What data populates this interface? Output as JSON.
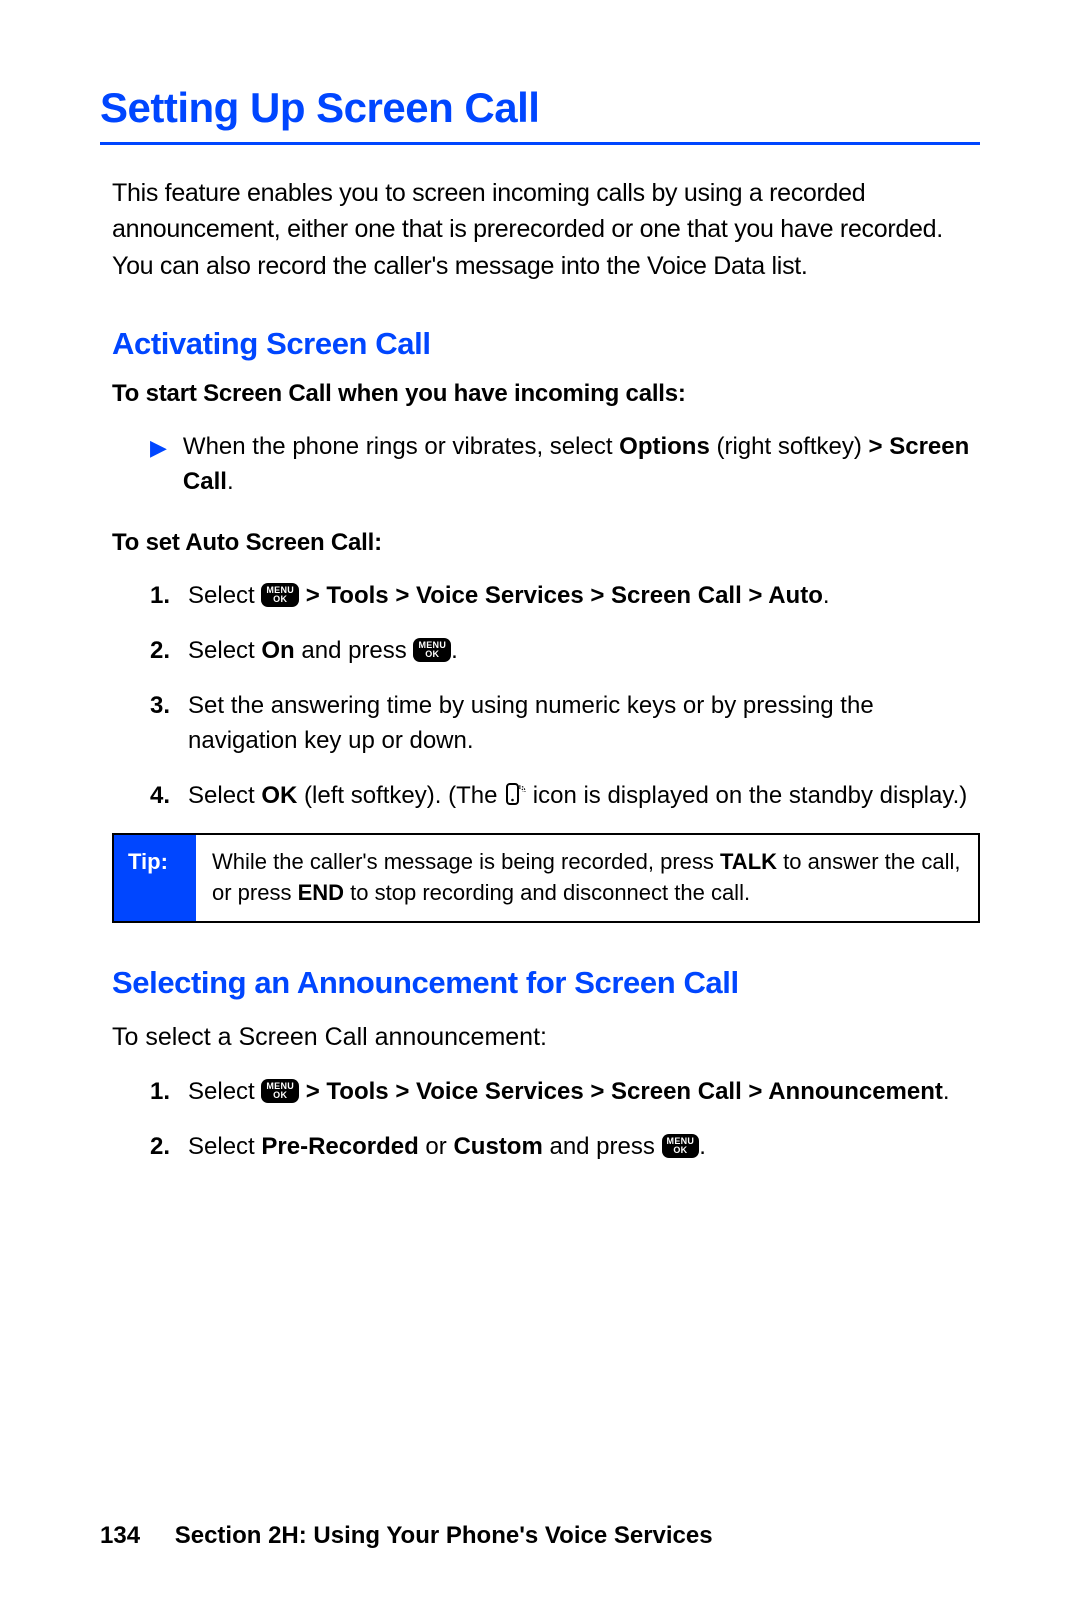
{
  "title": "Setting Up Screen Call",
  "intro": "This feature enables you to screen incoming calls by using a recorded announcement, either one that is prerecorded or one that you have recorded. You can also record the caller's message into the Voice Data list.",
  "section1": {
    "heading": "Activating Screen Call",
    "lead1": "To start Screen Call when you have incoming calls:",
    "arrow_pre": "When the phone rings or vibrates, select ",
    "arrow_bold1": "Options",
    "arrow_mid": " (right softkey) ",
    "arrow_bold2": "> Screen Call",
    "arrow_post": ".",
    "lead2": "To set Auto Screen Call:",
    "steps": {
      "s1_pre": "Select ",
      "s1_bold": " > Tools > Voice Services > Screen Call > Auto",
      "s1_post": ".",
      "s2_pre": "Select ",
      "s2_bold": "On",
      "s2_mid": " and press ",
      "s2_post": ".",
      "s3": "Set the answering time by using numeric keys or by pressing the navigation key up or down.",
      "s4_pre": "Select ",
      "s4_bold": "OK",
      "s4_mid": " (left softkey). (The ",
      "s4_post": " icon is displayed on the standby display.)"
    },
    "tip_label": "Tip:",
    "tip_pre": "While the caller's message is being recorded, press ",
    "tip_b1": "TALK",
    "tip_mid": " to answer the call, or press ",
    "tip_b2": "END",
    "tip_post": " to stop recording and disconnect the call."
  },
  "section2": {
    "heading": "Selecting an Announcement for Screen Call",
    "intro": "To select a Screen Call announcement:",
    "steps": {
      "s1_pre": "Select ",
      "s1_bold": " > Tools > Voice Services > Screen Call > Announcement",
      "s1_post": ".",
      "s2_pre": "Select ",
      "s2_b1": "Pre-Recorded",
      "s2_mid": " or ",
      "s2_b2": "Custom",
      "s2_mid2": " and press ",
      "s2_post": "."
    }
  },
  "menu_key": {
    "line1": "MENU",
    "line2": "OK"
  },
  "footer": {
    "page": "134",
    "section": "Section 2H: Using Your Phone's Voice Services"
  },
  "list_numbers": {
    "n1": "1.",
    "n2": "2.",
    "n3": "3.",
    "n4": "4."
  }
}
